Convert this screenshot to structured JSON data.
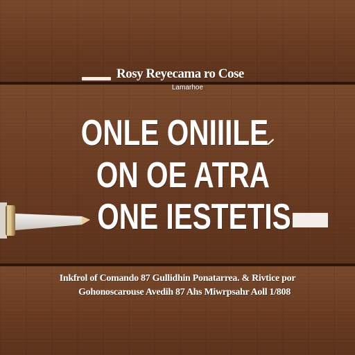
{
  "header": {
    "title": "Rosy Reyecama ro Cose",
    "subtitle": "Lamarhoe"
  },
  "headline": {
    "line1": "ONLE ONIIILE",
    "line2": "ON OE ATRA",
    "line3": "ONE IESTETIS"
  },
  "footer": {
    "line1": "Inkfrol of Comando 87 Gullidhin Ponatarrea. & Rivtice por",
    "line2": "Gohonoscarouse Avedih 87 Ahs Miwrpsahr Aoll 1/808"
  },
  "colors": {
    "text": "#ffffff",
    "wood_light": "#7a4a2c",
    "wood_dark": "#5e341d",
    "board_gap": "#2a160c",
    "brass": "#c9a46a"
  },
  "icons": {
    "tool": "pen-knife-icon",
    "tick": "pen-tick-icon"
  }
}
